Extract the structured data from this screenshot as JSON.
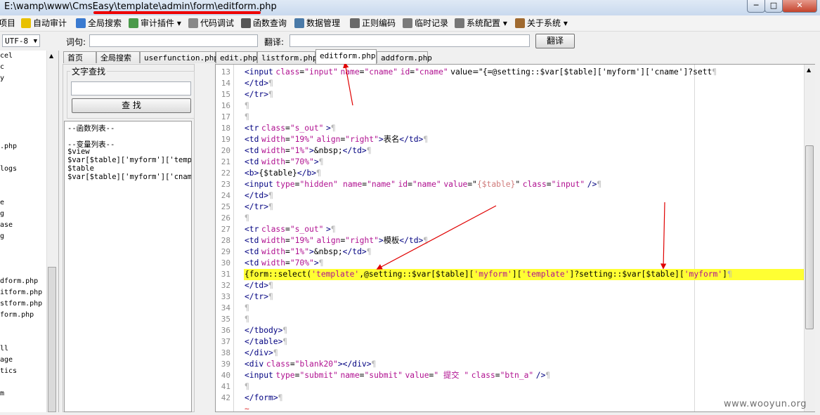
{
  "window": {
    "title": "E:\\wamp\\www\\CmsEasy\\template\\admin\\form\\editform.php",
    "minimize": "─",
    "maximize": "□",
    "close": "✕"
  },
  "menu": [
    {
      "label": "项目",
      "icon": "project-icon"
    },
    {
      "label": "自动审计",
      "icon": "auto-audit-icon"
    },
    {
      "label": "全局搜索",
      "icon": "global-search-icon"
    },
    {
      "label": "审计插件 ▾",
      "icon": "audit-plugin-icon"
    },
    {
      "label": "代码调试",
      "icon": "code-debug-icon"
    },
    {
      "label": "函数查询",
      "icon": "function-query-icon"
    },
    {
      "label": "数据管理",
      "icon": "data-manage-icon"
    },
    {
      "label": "正则编码",
      "icon": "regex-encode-icon"
    },
    {
      "label": "临时记录",
      "icon": "temp-record-icon"
    },
    {
      "label": "系统配置 ▾",
      "icon": "gear-icon"
    },
    {
      "label": "关于系统 ▾",
      "icon": "about-icon"
    }
  ],
  "search": {
    "encoding": "UTF-8",
    "word_label": "词句:",
    "translate_label": "翻译:",
    "translate_button": "翻译"
  },
  "tree": [
    "cel",
    "c",
    "y",
    ".php",
    "logs",
    "e",
    "g",
    "ase",
    "g",
    "dform.php",
    "itform.php",
    "stform.php",
    "form.php",
    "ll",
    "age",
    "tics",
    "m"
  ],
  "tabs": [
    "首页",
    "全局搜索",
    "userfunction.php",
    "edit.php",
    "listform.php",
    "editform.php",
    "addform.php"
  ],
  "find": {
    "title": "文字查找",
    "button": "查 找"
  },
  "function_list": {
    "header": "--函数列表--",
    "var_header": "--变量列表--",
    "vars": [
      "$view",
      "$var[$table]['myform']['templ",
      "$table",
      "$var[$table]['myform']['cname'"
    ]
  },
  "code_lines": [
    {
      "n": "13",
      "code": "<input class=\"input\" name=\"cname\" id=\"cname\" value=\"{=@setting::$var[$table]['myform']['cname']?sett"
    },
    {
      "n": "14",
      "code": "</td>"
    },
    {
      "n": "15",
      "code": "</tr>"
    },
    {
      "n": "16",
      "code": ""
    },
    {
      "n": "17",
      "code": ""
    },
    {
      "n": "18",
      "code": "<tr class=\"s_out\" >"
    },
    {
      "n": "19",
      "code": "<td width=\"19%\" align=\"right\">表名</td>"
    },
    {
      "n": "20",
      "code": "<td width=\"1%\">&nbsp;</td>"
    },
    {
      "n": "21",
      "code": "<td width=\"70%\">"
    },
    {
      "n": "22",
      "code": "<b>{$table}</b>"
    },
    {
      "n": "23",
      "code": "<input type=\"hidden\"  name=\"name\" id=\"name\" value=\"{$table}\" class=\"input\" />"
    },
    {
      "n": "24",
      "code": "</td>"
    },
    {
      "n": "25",
      "code": "</tr>"
    },
    {
      "n": "26",
      "code": ""
    },
    {
      "n": "27",
      "code": "<tr class=\"s_out\" >"
    },
    {
      "n": "28",
      "code": "<td width=\"19%\" align=\"right\">模板</td>"
    },
    {
      "n": "29",
      "code": "<td width=\"1%\">&nbsp;</td>"
    },
    {
      "n": "30",
      "code": "<td width=\"70%\">"
    },
    {
      "n": "31",
      "code": "{form::select('template',@setting::$var[$table]['myform']['template']?setting::$var[$table]['myform']"
    },
    {
      "n": "32",
      "code": "</td>"
    },
    {
      "n": "33",
      "code": "</tr>"
    },
    {
      "n": "34",
      "code": ""
    },
    {
      "n": "35",
      "code": ""
    },
    {
      "n": "36",
      "code": "</tbody>"
    },
    {
      "n": "37",
      "code": "</table>"
    },
    {
      "n": "38",
      "code": "</div>"
    },
    {
      "n": "39",
      "code": "<div class=\"blank20\"></div>"
    },
    {
      "n": "40",
      "code": "<input type=\"submit\" name=\"submit\" value=\" 提交 \" class=\"btn_a\" />"
    },
    {
      "n": "41",
      "code": ""
    },
    {
      "n": "42",
      "code": "</form>"
    }
  ],
  "eof_marker": "~",
  "highlight_line": "31",
  "colors": {
    "tag": "#000080",
    "attr": "#b01090",
    "highlight": "#ffff33",
    "arrow": "#e00000"
  },
  "watermark": "www.wooyun.org"
}
